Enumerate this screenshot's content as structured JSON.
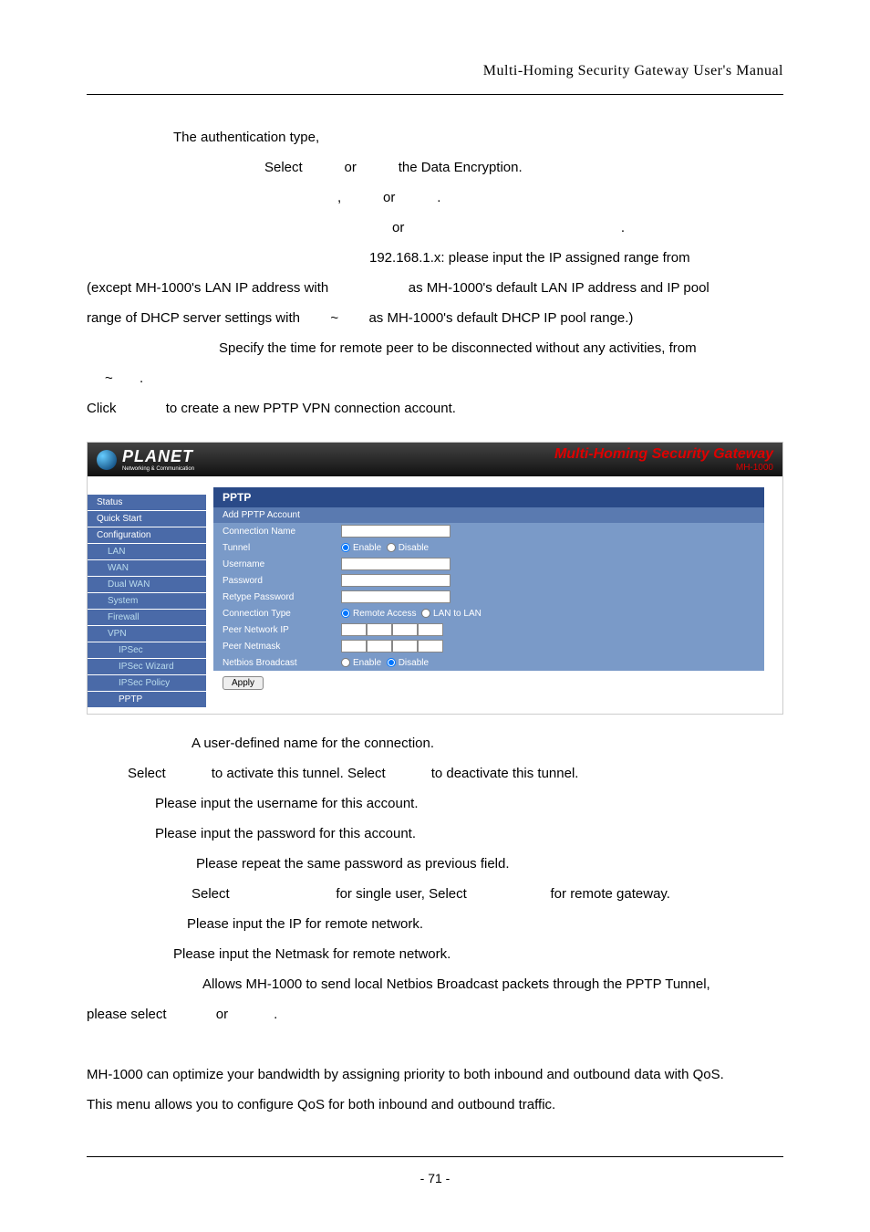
{
  "header": {
    "title": "Multi-Homing  Security  Gateway  User's  Manual"
  },
  "intro": {
    "l1a": "The authentication type,",
    "l2a": "Select",
    "l2b": "or",
    "l2c": "the Data Encryption.",
    "l3a": ",",
    "l3b": "or",
    "l3c": ".",
    "l4a": "or",
    "l4b": ".",
    "l5": "192.168.1.x: please input the IP assigned range from",
    "l6a": "(except MH-1000's LAN IP address with",
    "l6b": "as MH-1000's default LAN IP address and IP pool",
    "l7a": "range of DHCP server settings with",
    "l7b": "~",
    "l7c": "as MH-1000's default DHCP IP pool range.)",
    "l8": "Specify the time for remote peer to be disconnected without any activities, from",
    "l9a": "~",
    "l9b": ".",
    "l10a": "Click",
    "l10b": "to create a new PPTP VPN connection account."
  },
  "screenshot": {
    "brand": "PLANET",
    "brand_sub": "Networking & Communication",
    "title": "Multi-Homing Security Gateway",
    "model": "MH-1000",
    "nav": [
      "Status",
      "Quick Start",
      "Configuration",
      "LAN",
      "WAN",
      "Dual WAN",
      "System",
      "Firewall",
      "VPN",
      "IPSec",
      "IPSec Wizard",
      "IPSec Policy",
      "PPTP"
    ],
    "panel_title": "PPTP",
    "panel_sub": "Add PPTP Account",
    "rows": {
      "r1": "Connection Name",
      "r2": "Tunnel",
      "r2a": "Enable",
      "r2b": "Disable",
      "r3": "Username",
      "r4": "Password",
      "r5": "Retype Password",
      "r6": "Connection Type",
      "r6a": "Remote Access",
      "r6b": "LAN to LAN",
      "r7": "Peer Network IP",
      "r8": "Peer Netmask",
      "r9": "Netbios Broadcast",
      "r9a": "Enable",
      "r9b": "Disable"
    },
    "apply": "Apply"
  },
  "desc": {
    "d1": "A user-defined name for the connection.",
    "d2a": "Select",
    "d2b": "to activate this tunnel. Select",
    "d2c": "to deactivate this tunnel.",
    "d3": "Please input the username for this account.",
    "d4": "Please input the password for this account.",
    "d5": "Please repeat the same password as previous field.",
    "d6a": "Select",
    "d6b": "for single user, Select",
    "d6c": "for remote gateway.",
    "d7": "Please input the IP for remote network.",
    "d8": "Please input the Netmask for remote network.",
    "d9": "Allows MH-1000 to send local Netbios Broadcast packets through the PPTP Tunnel,",
    "d10a": "please select",
    "d10b": "or",
    "d10c": ".",
    "qos1": "MH-1000 can optimize your bandwidth by assigning priority to both inbound and outbound data with QoS.",
    "qos2": "This menu allows you to configure QoS for both inbound and outbound traffic."
  },
  "footer": {
    "page": "- 71 -"
  }
}
